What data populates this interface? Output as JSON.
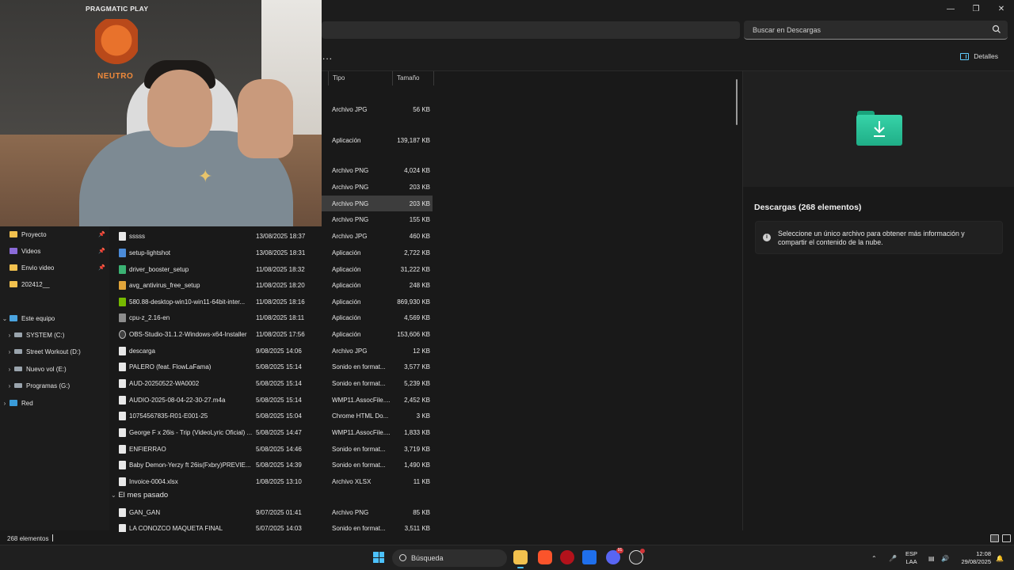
{
  "search": {
    "placeholder": "Buscar en Descargas"
  },
  "toolbar": {
    "more_label": "...",
    "details_label": "Detalles"
  },
  "columns": {
    "type": "Tipo",
    "size": "Tamaño"
  },
  "webcam": {
    "brand": "PRAGMATIC PLAY",
    "logo_text": "NEUTRO"
  },
  "sidebar": {
    "quick": [
      {
        "label": "Proyecto",
        "pinned": true
      },
      {
        "label": "Videos",
        "pinned": true
      },
      {
        "label": "Envio video",
        "pinned": true
      },
      {
        "label": "202412__",
        "pinned": false
      }
    ],
    "this_pc": "Este equipo",
    "drives": [
      "SYSTEM (C:)",
      "Street Workout (D:)",
      "Nuevo vol (E:)",
      "Programas (G:)"
    ],
    "network": "Red"
  },
  "files_top": [
    {
      "type": "Archivo JPG",
      "size": "56 KB"
    },
    {
      "type": "Aplicación",
      "size": "139,187 KB"
    },
    {
      "type": "Archivo PNG",
      "size": "4,024 KB"
    },
    {
      "type": "Archivo PNG",
      "size": "203 KB"
    },
    {
      "type": "Archivo PNG",
      "size": "203 KB"
    },
    {
      "type": "Archivo PNG",
      "size": "155 KB"
    }
  ],
  "files": [
    {
      "name": "sssss",
      "date": "13/08/2025 18:37",
      "type": "Archivo JPG",
      "size": "460 KB"
    },
    {
      "name": "setup-lightshot",
      "date": "13/08/2025 18:31",
      "type": "Aplicación",
      "size": "2,722 KB"
    },
    {
      "name": "driver_booster_setup",
      "date": "11/08/2025 18:32",
      "type": "Aplicación",
      "size": "31,222 KB"
    },
    {
      "name": "avg_antivirus_free_setup",
      "date": "11/08/2025 18:20",
      "type": "Aplicación",
      "size": "248 KB"
    },
    {
      "name": "580.88-desktop-win10-win11-64bit-inter...",
      "date": "11/08/2025 18:16",
      "type": "Aplicación",
      "size": "869,930 KB"
    },
    {
      "name": "cpu-z_2.16-en",
      "date": "11/08/2025 18:11",
      "type": "Aplicación",
      "size": "4,569 KB"
    },
    {
      "name": "OBS-Studio-31.1.2-Windows-x64-Installer",
      "date": "11/08/2025 17:56",
      "type": "Aplicación",
      "size": "153,606 KB"
    },
    {
      "name": "descarga",
      "date": "9/08/2025 14:06",
      "type": "Archivo JPG",
      "size": "12 KB"
    },
    {
      "name": "PALERO (feat. FlowLaFama)",
      "date": "5/08/2025 15:14",
      "type": "Sonido en format...",
      "size": "3,577 KB"
    },
    {
      "name": "AUD-20250522-WA0002",
      "date": "5/08/2025 15:14",
      "type": "Sonido en format...",
      "size": "5,239 KB"
    },
    {
      "name": "AUDIO-2025-08-04-22-30-27.m4a",
      "date": "5/08/2025 15:14",
      "type": "WMP11.AssocFile....",
      "size": "2,452 KB"
    },
    {
      "name": "10754567835-R01-E001-25",
      "date": "5/08/2025 15:04",
      "type": "Chrome HTML Do...",
      "size": "3 KB"
    },
    {
      "name": "George F x 26is - Trip (VideoLyric Oficial) ...",
      "date": "5/08/2025 14:47",
      "type": "WMP11.AssocFile....",
      "size": "1,833 KB"
    },
    {
      "name": "ENFIERRAO",
      "date": "5/08/2025 14:46",
      "type": "Sonido en format...",
      "size": "3,719 KB"
    },
    {
      "name": "Baby Demon-Yerzy ft 26is(Fxbry)PREVIE...",
      "date": "5/08/2025 14:39",
      "type": "Sonido en format...",
      "size": "1,490 KB"
    },
    {
      "name": "Invoice-0004.xlsx",
      "date": "1/08/2025 13:10",
      "type": "Archivo XLSX",
      "size": "11 KB"
    }
  ],
  "group_last_month": "El mes pasado",
  "files_last_month": [
    {
      "name": "GAN_GAN",
      "date": "9/07/2025 01:41",
      "type": "Archivo PNG",
      "size": "85 KB"
    },
    {
      "name": "LA CONOZCO MAQUETA FINAL",
      "date": "5/07/2025 14:03",
      "type": "Sonido en format...",
      "size": "3,511 KB"
    }
  ],
  "details": {
    "title": "Descargas (268 elementos)",
    "info": "Seleccione un único archivo para obtener más información y compartir el contenido de la nube."
  },
  "status": {
    "count": "268 elementos"
  },
  "taskbar": {
    "search_label": "Búsqueda",
    "lang_top": "ESP",
    "lang_bottom": "LAA",
    "time": "12:08",
    "date": "29/08/2025",
    "discord_badge": "91"
  },
  "colors": {
    "accent": "#4cc2ff",
    "folder": "#f2c14e",
    "download_folder": "#2cc79b"
  }
}
